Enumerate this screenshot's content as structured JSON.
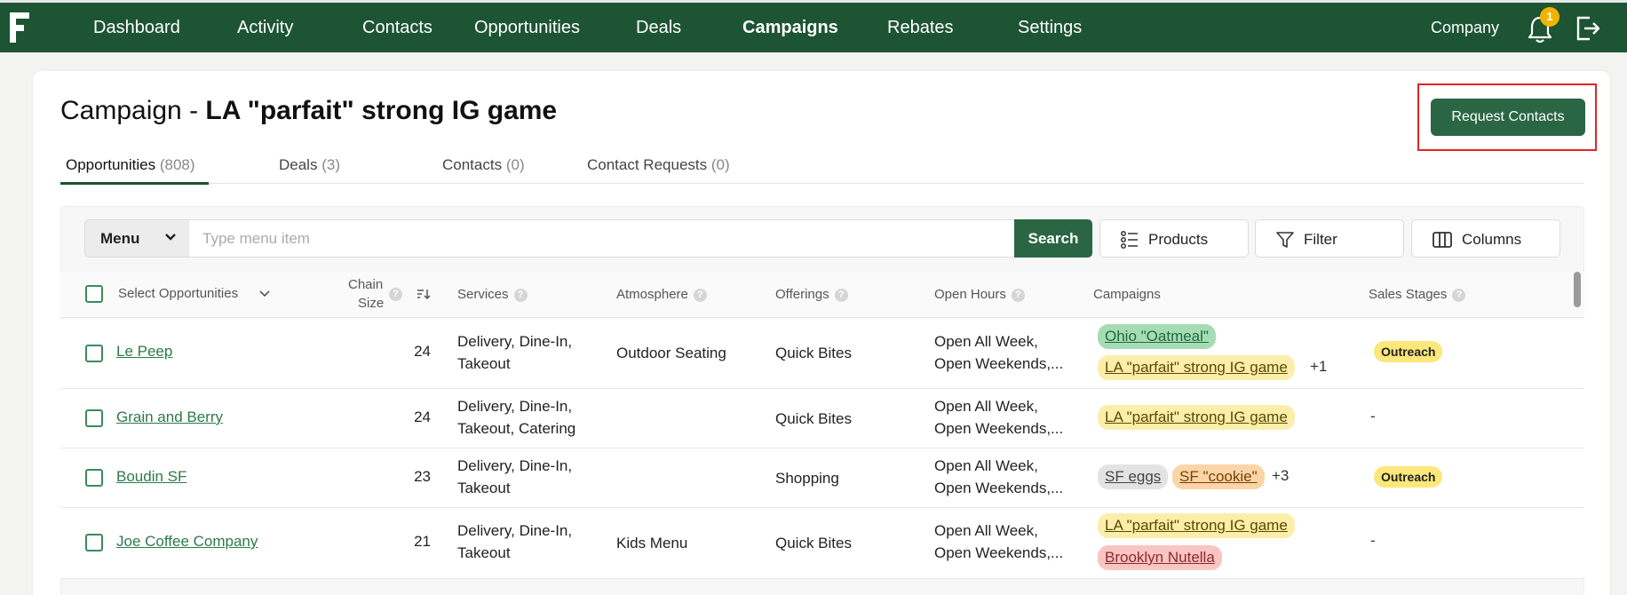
{
  "nav": {
    "items": [
      "Dashboard",
      "Activity",
      "Contacts",
      "Opportunities",
      "Deals",
      "Campaigns",
      "Rebates",
      "Settings"
    ],
    "active": "Campaigns",
    "company": "Company",
    "notification_count": "1",
    "brand_color": "#1d5433"
  },
  "page": {
    "title_prefix": "Campaign - ",
    "title_name": "LA \"parfait\" strong IG game",
    "request_button": "Request Contacts"
  },
  "tabs": [
    {
      "label": "Opportunities",
      "count": "(808)",
      "active": true
    },
    {
      "label": "Deals",
      "count": "(3)",
      "active": false
    },
    {
      "label": "Contacts",
      "count": "(0)",
      "active": false
    },
    {
      "label": "Contact Requests",
      "count": "(0)",
      "active": false
    }
  ],
  "toolbar": {
    "menu_label": "Menu",
    "search_placeholder": "Type menu item",
    "search_button": "Search",
    "products_button": "Products",
    "filter_button": "Filter",
    "columns_button": "Columns"
  },
  "table": {
    "headers": {
      "select": "Select Opportunities",
      "chain_line1": "Chain",
      "chain_line2": "Size",
      "services": "Services",
      "atmosphere": "Atmosphere",
      "offerings": "Offerings",
      "open_hours": "Open Hours",
      "campaigns": "Campaigns",
      "sales_stages": "Sales Stages"
    },
    "rows": [
      {
        "name": "Le Peep",
        "chain": "24",
        "services": [
          "Delivery, Dine-In,",
          "Takeout"
        ],
        "atmosphere": "Outdoor Seating",
        "offerings": "Quick Bites",
        "hours": [
          "Open All Week,",
          "Open Weekends,..."
        ],
        "campaigns": [
          "Ohio \"Oatmeal\"",
          "LA \"parfait\" strong IG game"
        ],
        "campaigns_more": "+1",
        "stage": "Outreach"
      },
      {
        "name": "Grain and Berry",
        "chain": "24",
        "services": [
          "Delivery, Dine-In,",
          "Takeout, Catering"
        ],
        "atmosphere": "",
        "offerings": "Quick Bites",
        "hours": [
          "Open All Week,",
          "Open Weekends,..."
        ],
        "campaigns": [
          "LA \"parfait\" strong IG game"
        ],
        "campaigns_more": "",
        "stage": "-"
      },
      {
        "name": "Boudin SF",
        "chain": "23",
        "services": [
          "Delivery, Dine-In,",
          "Takeout"
        ],
        "atmosphere": "",
        "offerings": "Shopping",
        "hours": [
          "Open All Week,",
          "Open Weekends,..."
        ],
        "campaigns": [
          "SF eggs",
          "SF \"cookie\""
        ],
        "campaigns_more": "+3",
        "stage": "Outreach"
      },
      {
        "name": "Joe Coffee Company",
        "chain": "21",
        "services": [
          "Delivery, Dine-In,",
          "Takeout"
        ],
        "atmosphere": "Kids Menu",
        "offerings": "Quick Bites",
        "hours": [
          "Open All Week,",
          "Open Weekends,..."
        ],
        "campaigns": [
          "LA \"parfait\" strong IG game",
          "Brooklyn Nutella"
        ],
        "campaigns_more": "",
        "stage": "-"
      }
    ]
  }
}
